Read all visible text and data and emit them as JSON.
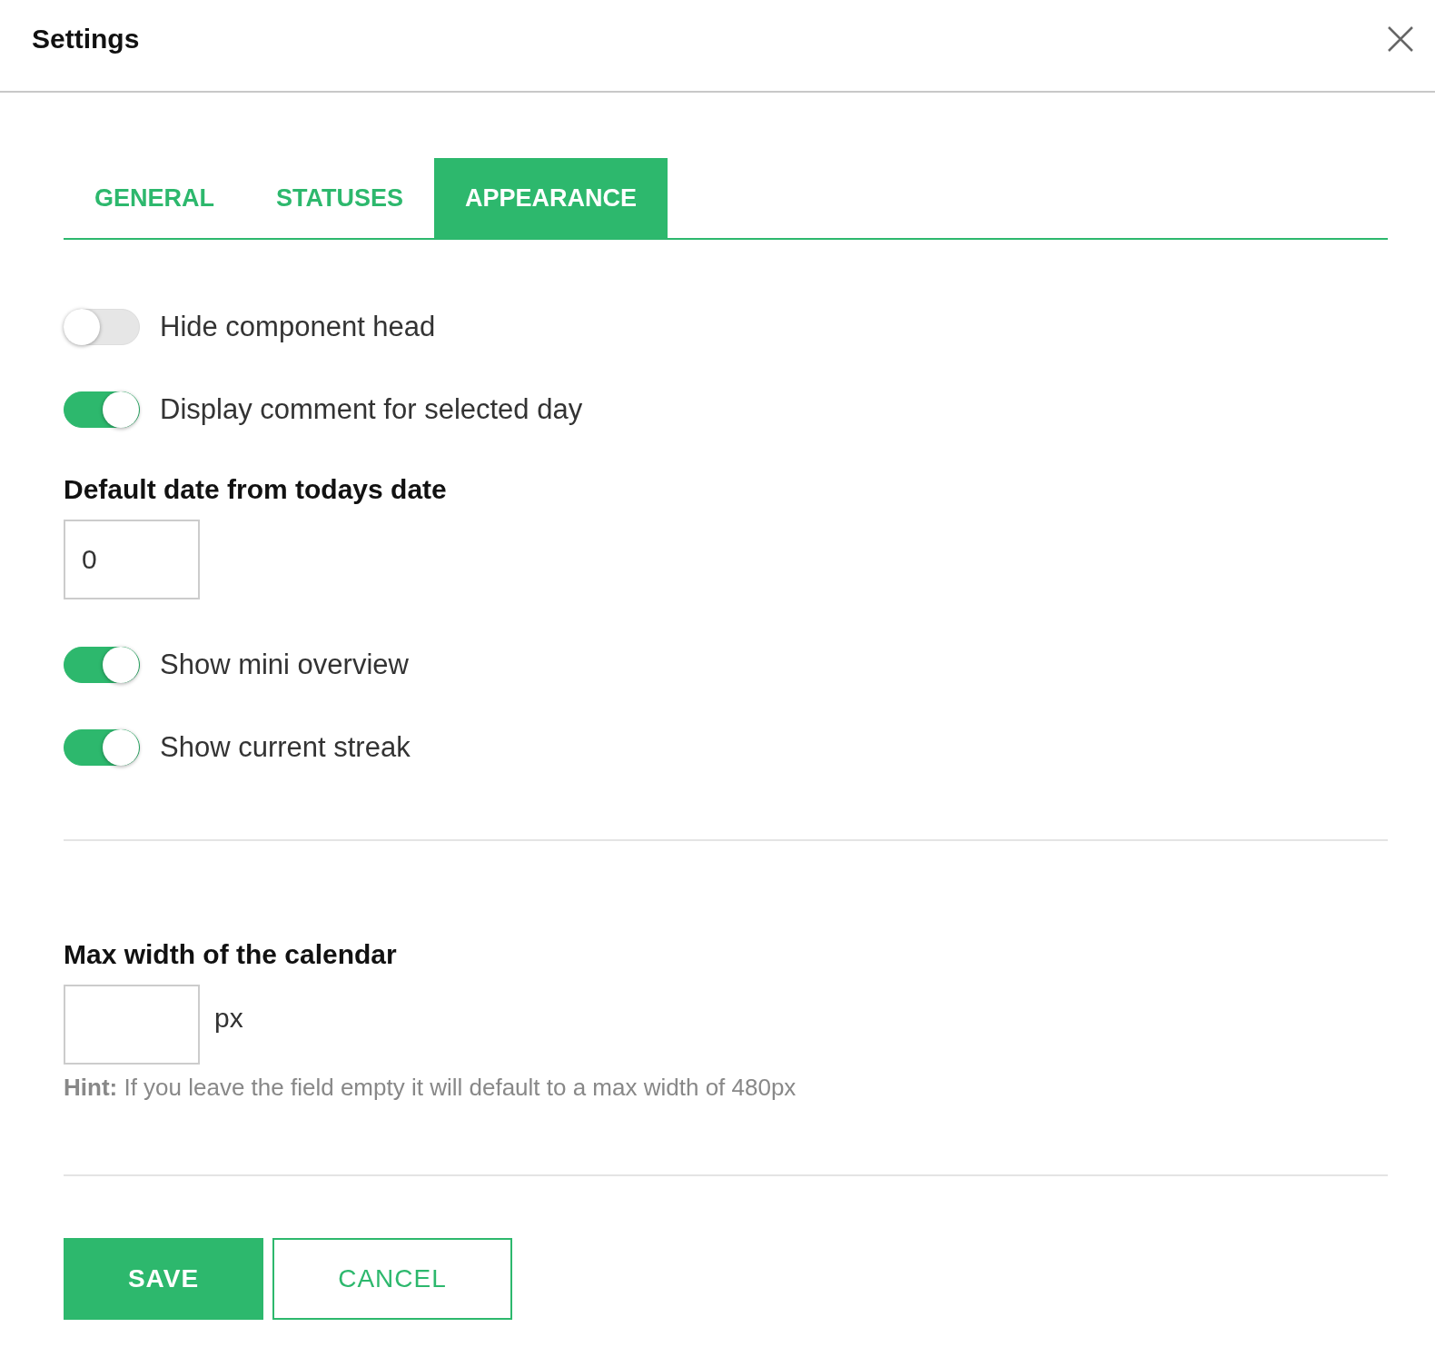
{
  "window": {
    "title": "Settings"
  },
  "tabs": [
    {
      "label": "GENERAL",
      "selected": false
    },
    {
      "label": "STATUSES",
      "selected": false
    },
    {
      "label": "APPEARANCE",
      "selected": true
    }
  ],
  "section_1": {
    "items": [
      {
        "kind": "toggle",
        "label": "Hide component head",
        "on": false
      },
      {
        "kind": "toggle",
        "label": "Display comment for selected day",
        "on": true
      },
      {
        "kind": "number",
        "label": "Default date from todays date",
        "value": "0"
      },
      {
        "kind": "toggle",
        "label": "Show mini overview",
        "on": true
      },
      {
        "kind": "toggle",
        "label": "Show current streak",
        "on": true
      }
    ]
  },
  "section_2": {
    "label": "Max width of the calendar",
    "unit": "px",
    "hint": "**Hint:** If you leave the field empty it will default to a max width of 480px"
  },
  "buttons": [
    {
      "kind": "primary",
      "label": "SAVE"
    },
    {
      "kind": "secondary",
      "label": "CANCEL"
    }
  ]
}
